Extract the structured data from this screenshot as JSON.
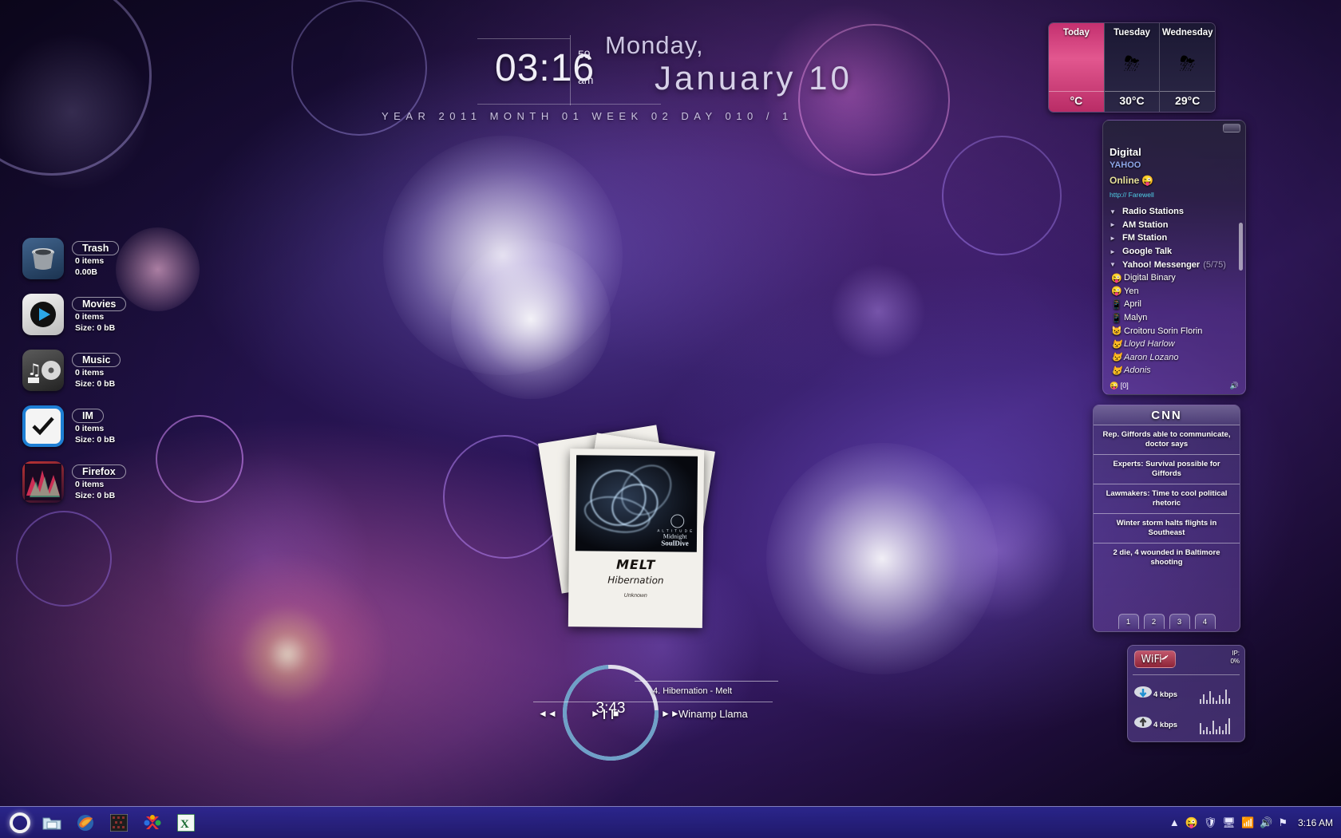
{
  "clock": {
    "time": "03:16",
    "seconds": "59",
    "ampm": "am",
    "dayname": "Monday,",
    "monthday": "January 10",
    "datestrip": "YEAR 2011   MONTH 01   WEEK 02   DAY 010 / 1"
  },
  "weather": {
    "columns": [
      {
        "day": "Today",
        "icon": "",
        "temp": "°C",
        "accent": "#c4306f"
      },
      {
        "day": "Tuesday",
        "icon": "⛈",
        "temp": "30°C"
      },
      {
        "day": "Wednesday",
        "icon": "⛈",
        "temp": "29°C"
      }
    ]
  },
  "messenger": {
    "display_name": "Digital",
    "network": "YAHOO",
    "status": "Online",
    "status_emoji": "😜",
    "url": "http:// Farewell",
    "groups": [
      {
        "label": "Radio Stations",
        "arrow": "▼",
        "count": ""
      },
      {
        "label": "AM Station",
        "arrow": "►",
        "count": ""
      },
      {
        "label": "FM Station",
        "arrow": "►",
        "count": ""
      },
      {
        "label": "Google Talk",
        "arrow": "►",
        "count": ""
      },
      {
        "label": "Yahoo! Messenger",
        "arrow": "▼",
        "count": "(5/75)"
      }
    ],
    "contacts": [
      {
        "name": "Digital Binary",
        "avatar": "😜",
        "online": true
      },
      {
        "name": "Yen",
        "avatar": "😜",
        "online": true
      },
      {
        "name": "April",
        "avatar": "📱",
        "online": true
      },
      {
        "name": "Malyn",
        "avatar": "📱",
        "online": true
      },
      {
        "name": "Croitoru Sorin Florin",
        "avatar": "😺",
        "online": true
      },
      {
        "name": "Lloyd Harlow",
        "avatar": "😾",
        "online": false
      },
      {
        "name": "Aaron Lozano",
        "avatar": "😾",
        "online": false
      },
      {
        "name": "Adonis",
        "avatar": "😾",
        "online": false
      }
    ],
    "footer_emoji": "😜",
    "footer_count": "[0]",
    "footer_right": "🔊"
  },
  "cnn": {
    "title": "CNN",
    "headlines": [
      "Rep. Giffords able to communicate, doctor says",
      "Experts: Survival possible for Giffords",
      "Lawmakers: Time to cool political rhetoric",
      "Winter storm halts flights in Southeast",
      "2 die, 4 wounded in Baltimore shooting"
    ],
    "pages": [
      "1",
      "2",
      "3",
      "4"
    ]
  },
  "wifi": {
    "label": "WiFi",
    "ip_label": "IP:",
    "ip_value": "0%",
    "download_rate": "4 kbps",
    "upload_rate": "4 kbps"
  },
  "player": {
    "album_title": "MELT",
    "track_title": "Hibernation",
    "artist": "Unknown",
    "art_brand_small": "A L T I T U D E",
    "art_brand_line1": "Midnight",
    "art_brand_line2": "SoulDive",
    "elapsed": "3:43",
    "track_label": "4. Hibernation - Melt",
    "app_label": "Winamp Llama",
    "controls": {
      "prev": "◄◄",
      "play": "►",
      "pause": "❙❙",
      "stop": "■",
      "next": "►►"
    }
  },
  "desktop_icons": [
    {
      "name": "Trash",
      "items": "0 items",
      "size": "0.00B",
      "icon": "trash-icon"
    },
    {
      "name": "Movies",
      "items": "0 items",
      "size": "Size: 0 bB",
      "icon": "play-icon"
    },
    {
      "name": "Music",
      "items": "0 items",
      "size": "Size: 0 bB",
      "icon": "music-note-icon"
    },
    {
      "name": "IM",
      "items": "0 items",
      "size": "Size: 0 bB",
      "icon": "checkmark-icon"
    },
    {
      "name": "Firefox",
      "items": "0 items",
      "size": "Size: 0 bB",
      "icon": "firefox-icon"
    }
  ],
  "taskbar": {
    "start_label": "start-orb",
    "items": [
      {
        "icon": "folder-icon",
        "glyph": "🗂"
      },
      {
        "icon": "firefox-icon",
        "glyph": "🦊"
      },
      {
        "icon": "terminal-icon",
        "glyph": "▦"
      },
      {
        "icon": "puzzle-icon",
        "glyph": "✖"
      },
      {
        "icon": "excel-icon",
        "glyph": "X"
      }
    ],
    "tray": [
      {
        "icon": "chevron-up-icon",
        "glyph": "▲"
      },
      {
        "icon": "messenger-icon",
        "glyph": "😜"
      },
      {
        "icon": "shield-icon",
        "glyph": "🛡"
      },
      {
        "icon": "monitor-icon",
        "glyph": "🖥"
      },
      {
        "icon": "network-icon",
        "glyph": "📶"
      },
      {
        "icon": "volume-icon",
        "glyph": "🔊"
      },
      {
        "icon": "flag-icon",
        "glyph": "⚑"
      }
    ],
    "clock": "3:16 AM"
  }
}
